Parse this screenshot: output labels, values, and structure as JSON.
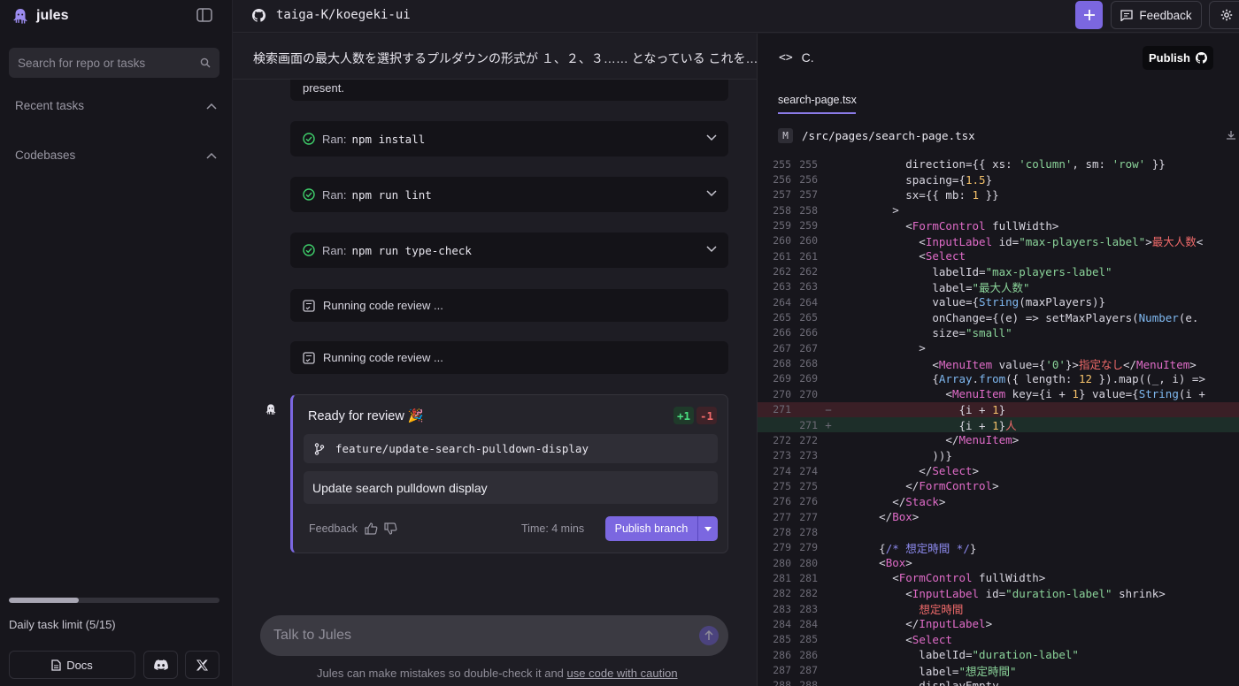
{
  "sidebar": {
    "logo_text": "jules",
    "search_placeholder": "Search for repo or tasks",
    "sections": [
      {
        "label": "Recent tasks"
      },
      {
        "label": "Codebases"
      }
    ],
    "task_limit_label": "Daily task limit (5/15)",
    "task_limit_fraction": 0.333,
    "docs_label": "Docs"
  },
  "topbar": {
    "repo": "taiga-K/koegeki-ui",
    "feedback_label": "Feedback"
  },
  "chat": {
    "title": "検索画面の最大人数を選択するプルダウンの形式が １、２、３…… となっている これを…",
    "partial_text": "present.",
    "steps": [
      {
        "prefix": "Ran:",
        "command": "npm install"
      },
      {
        "prefix": "Ran:",
        "command": "npm run lint"
      },
      {
        "prefix": "Ran:",
        "command": "npm run type-check"
      }
    ],
    "reviews": [
      {
        "label": "Running code review ..."
      },
      {
        "label": "Running code review ..."
      }
    ],
    "card": {
      "title": "Ready for review 🎉",
      "additions": "+1",
      "deletions": "-1",
      "branch": "feature/update-search-pulldown-display",
      "description": "Update search pulldown display",
      "feedback_label": "Feedback",
      "time": "Time: 4 mins",
      "publish_label": "Publish branch"
    },
    "input_placeholder": "Talk to Jules",
    "disclaimer_text": "Jules can make mistakes so double-check it and ",
    "disclaimer_link": "use code with caution",
    "colors": {
      "accent": "#7b67e0",
      "success": "#3fcf6b",
      "add": "#4ade80",
      "del": "#f06a6a"
    }
  },
  "code": {
    "header_label": "C.",
    "publish_label": "Publish",
    "file_tab": "search-page.tsx",
    "file_badge": "M",
    "file_path": "/src/pages/search-page.tsx",
    "lines": [
      {
        "a": "255",
        "b": "255",
        "t": "add",
        "d": 0,
        "html": "          direction={{ xs: <s>'column'</s>, sm: <s>'row'</s> }}"
      },
      {
        "a": "256",
        "b": "256",
        "d": 0,
        "html": "          spacing={<n>1.5</n>}"
      },
      {
        "a": "257",
        "b": "257",
        "d": 0,
        "html": "          sx={{ mb: <n>1</n> }}"
      },
      {
        "a": "258",
        "b": "258",
        "d": 0,
        "html": "        >"
      },
      {
        "a": "259",
        "b": "259",
        "d": 0,
        "html": "          &lt;<g>FormControl</g> fullWidth>"
      },
      {
        "a": "260",
        "b": "260",
        "d": 0,
        "html": "            &lt;<g>InputLabel</g> id=<s>\"max-players-label\"</s>><j>最大人数</j>&lt;"
      },
      {
        "a": "261",
        "b": "261",
        "d": 0,
        "html": "            &lt;<g>Select</g>"
      },
      {
        "a": "262",
        "b": "262",
        "d": 0,
        "html": "              labelId=<s>\"max-players-label\"</s>"
      },
      {
        "a": "263",
        "b": "263",
        "d": 0,
        "html": "              label=<s>\"最大人数\"</s>"
      },
      {
        "a": "264",
        "b": "264",
        "d": 0,
        "html": "              value={<f>String</f>(maxPlayers)}"
      },
      {
        "a": "265",
        "b": "265",
        "d": 0,
        "html": "              onChange={(e) => setMaxPlayers(<f>Number</f>(e."
      },
      {
        "a": "266",
        "b": "266",
        "d": 0,
        "html": "              size=<s>\"small\"</s>"
      },
      {
        "a": "267",
        "b": "267",
        "d": 0,
        "html": "            >"
      },
      {
        "a": "268",
        "b": "268",
        "d": 0,
        "html": "              &lt;<g>MenuItem</g> value={<s>'0'</s>}><j>指定なし</j>&lt;/<g>MenuItem</g>>"
      },
      {
        "a": "269",
        "b": "269",
        "d": 0,
        "html": "              {<f>Array</f>.<f>from</f>({ length: <n>12</n> }).map((_, i) =>"
      },
      {
        "a": "270",
        "b": "270",
        "d": 0,
        "html": "                &lt;<g>MenuItem</g> key={i + <n>1</n>} value={<f>String</f>(i +"
      },
      {
        "a": "271",
        "b": "",
        "m": "−",
        "d": 1,
        "html": "                  {i + <n>1</n>}"
      },
      {
        "a": "",
        "b": "271",
        "m": "+",
        "d": 2,
        "html": "                  {i + <n>1</n>}<j>人</j>"
      },
      {
        "a": "272",
        "b": "272",
        "d": 0,
        "html": "                &lt;/<g>MenuItem</g>>"
      },
      {
        "a": "273",
        "b": "273",
        "d": 0,
        "html": "              ))}"
      },
      {
        "a": "274",
        "b": "274",
        "d": 0,
        "html": "            &lt;/<g>Select</g>>"
      },
      {
        "a": "275",
        "b": "275",
        "d": 0,
        "html": "          &lt;/<g>FormControl</g>>"
      },
      {
        "a": "276",
        "b": "276",
        "d": 0,
        "html": "        &lt;/<g>Stack</g>>"
      },
      {
        "a": "277",
        "b": "277",
        "d": 0,
        "html": "      &lt;/<g>Box</g>>"
      },
      {
        "a": "278",
        "b": "278",
        "d": 0,
        "html": ""
      },
      {
        "a": "279",
        "b": "279",
        "d": 0,
        "html": "      {<c>/* 想定時間 */</c>}"
      },
      {
        "a": "280",
        "b": "280",
        "d": 0,
        "html": "      &lt;<g>Box</g>>"
      },
      {
        "a": "281",
        "b": "281",
        "d": 0,
        "html": "        &lt;<g>FormControl</g> fullWidth>"
      },
      {
        "a": "282",
        "b": "282",
        "d": 0,
        "html": "          &lt;<g>InputLabel</g> id=<s>\"duration-label\"</s> shrink>"
      },
      {
        "a": "283",
        "b": "283",
        "d": 0,
        "html": "            <j>想定時間</j>"
      },
      {
        "a": "284",
        "b": "284",
        "d": 0,
        "html": "          &lt;/<g>InputLabel</g>>"
      },
      {
        "a": "285",
        "b": "285",
        "d": 0,
        "html": "          &lt;<g>Select</g>"
      },
      {
        "a": "286",
        "b": "286",
        "d": 0,
        "html": "            labelId=<s>\"duration-label\"</s>"
      },
      {
        "a": "287",
        "b": "287",
        "d": 0,
        "html": "            label=<s>\"想定時間\"</s>"
      },
      {
        "a": "288",
        "b": "288",
        "d": 0,
        "html": "            displayEmpty"
      }
    ]
  }
}
